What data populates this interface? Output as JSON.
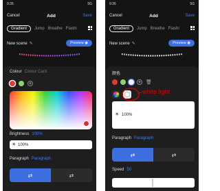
{
  "left": {
    "status_time": "9:35",
    "status_icons": "5G",
    "cancel": "Cancel",
    "title": "Add",
    "save": "Save",
    "tabs": [
      "Gradient",
      "Jump",
      "Breathe",
      "Flashi"
    ],
    "scene_name": "New scene",
    "preview": "Preview",
    "colour_label": "Colour",
    "colour_card": "Colour Card",
    "brightness_label": "Brightness",
    "brightness_value": "100%",
    "brightness_field": "100%",
    "paragraph_label": "Paragraph",
    "paragraph_value": "Paragraph",
    "seg_left": "⇄",
    "seg_right": "⇄"
  },
  "right": {
    "status_time": "9:36",
    "status_icons": "5G",
    "cancel": "Cancel",
    "title": "Add",
    "save": "Save",
    "tabs": [
      "Gradient",
      "Jump",
      "Breathe",
      "Flashi"
    ],
    "scene_name": "New scene",
    "preview": "Preview",
    "colour_label": "颜色",
    "brightness_field": "100%",
    "paragraph_label": "Paragraph",
    "paragraph_value": "Paragraph",
    "seg_left": "⇄",
    "seg_right": "⇄",
    "speed_label": "Speed",
    "speed_value": "50"
  },
  "annotation": "white light",
  "colors": {
    "accent": "#3d6fe0",
    "annotation": "#e00000",
    "swatch_red": "#e03a3a",
    "swatch_green": "#8fd36a",
    "swatch_white": "#f2f2f2"
  }
}
